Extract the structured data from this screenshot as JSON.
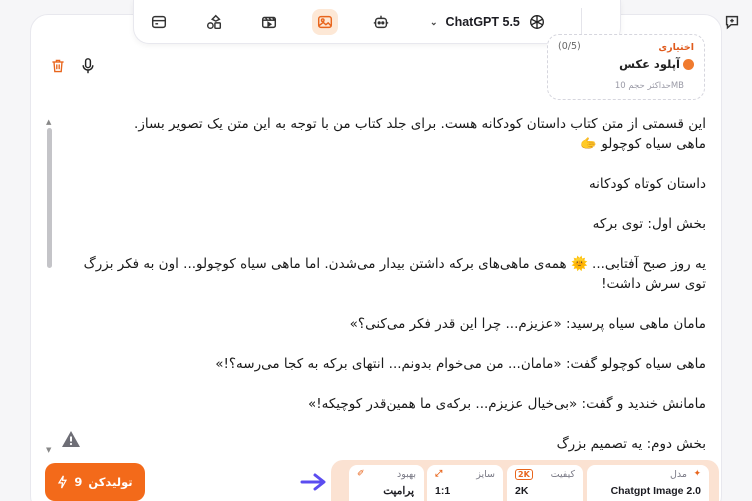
{
  "topbar": {
    "icons": [
      "card-icon",
      "shapes-icon",
      "video-icon",
      "image-icon",
      "robot-icon"
    ],
    "model_name": "ChatGPT 5.5",
    "model_logo": "openai-icon",
    "new_chat_icon": "new-chat-icon"
  },
  "upload": {
    "count": "(0/5)",
    "optional": "اختیاری",
    "title": "آپلود عکس",
    "hint": "حداکثر حجم 10MB"
  },
  "prompt": {
    "lines": [
      "این قسمتی از متن کتاب داستان کودکانه هست. برای جلد کتاب من با توجه به این متن یک تصویر بساز.",
      "ماهی سیاه کوچولو 🫱",
      "داستان کوتاه کودکانه",
      "بخش اول: توی برکه",
      "یه روز صبح آفتابی... 🌞 همه‌ی ماهی‌های برکه داشتن بیدار می‌شدن. اما ماهی سیاه کوچولو... اون به فکر بزرگ توی سرش داشت!",
      "مامان ماهی سیاه پرسید: «عزیزم... چرا این قدر فکر می‌کنی؟»",
      "ماهی سیاه کوچولو گفت: «مامان... من می‌خوام بدونم... انتهای برکه به کجا می‌رسه؟!»",
      "مامانش خندید و گفت: «بی‌خیال عزیزم... برکه‌ی ما همین‌قدر کوچیکه!»",
      "بخش دوم: یه تصمیم بزرگ"
    ]
  },
  "generate_button": {
    "label": "تولیدکن",
    "cost": "9"
  },
  "settings": {
    "model": {
      "label": "مدل",
      "value": "Chatgpt Image 2.0"
    },
    "quality": {
      "label": "کیفیت",
      "badge": "2K",
      "value": "2K"
    },
    "size": {
      "label": "سایز",
      "value": "1:1"
    },
    "enhance": {
      "label": "بهبود",
      "value": "پرامپت"
    }
  },
  "colors": {
    "accent": "#f36a1a",
    "settings_bg": "#fbe2d2",
    "arrow": "#5b4cf0"
  }
}
